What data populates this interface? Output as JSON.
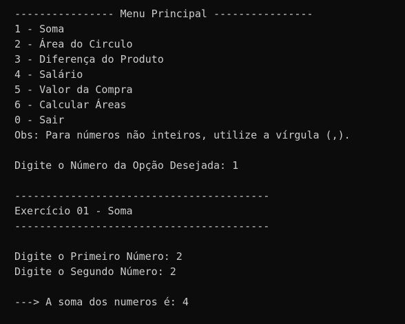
{
  "terminal": {
    "background_color": "#0c0c0c",
    "text_color": "#cccccc",
    "lines": [
      "---------------- Menu Principal ----------------",
      "1 - Soma",
      "2 - Área do Circulo",
      "3 - Diferença do Produto",
      "4 - Salário",
      "5 - Valor da Compra",
      "6 - Calcular Áreas",
      "0 - Sair",
      "Obs: Para números não inteiros, utilize a vírgula (,).",
      "",
      "Digite o Número da Opção Desejada: 1",
      "",
      "-----------------------------------------",
      "Exercício 01 - Soma",
      "-----------------------------------------",
      "",
      "Digite o Primeiro Número: 2",
      "Digite o Segundo Número: 2",
      "",
      "---> A soma dos numeros é: 4"
    ]
  }
}
